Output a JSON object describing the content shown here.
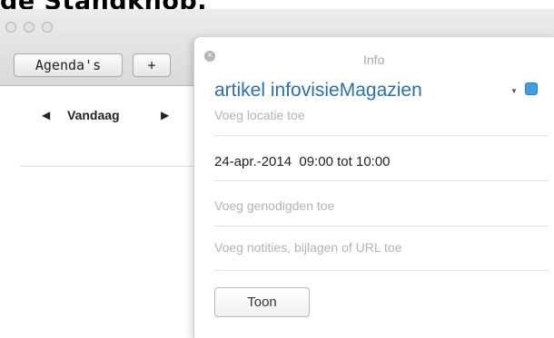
{
  "caption_text": "de Standknop.",
  "toolbar": {
    "calendars_label": "Agenda's",
    "add_label": "+"
  },
  "nav": {
    "prev_glyph": "◀",
    "today_label": "Vandaag",
    "next_glyph": "▶"
  },
  "popover": {
    "title": "Info",
    "close_glyph": "×",
    "event_title": "artikel infovisieMagazien",
    "calendar_dropdown_glyph": "▼",
    "calendar_color": "#3d9ee3",
    "location_placeholder": "Voeg locatie toe",
    "date": "24-apr.-2014",
    "time_range": "09:00 tot 10:00",
    "invitees_placeholder": "Voeg genodigden toe",
    "notes_placeholder": "Voeg notities, bijlagen of URL toe",
    "show_button_label": "Toon"
  }
}
